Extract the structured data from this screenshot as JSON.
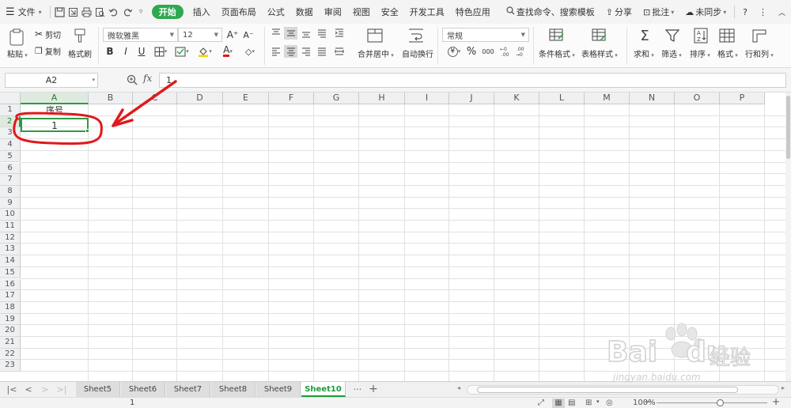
{
  "menubar": {
    "menu_label": "文件",
    "active_tab": "开始",
    "tabs": [
      "插入",
      "页面布局",
      "公式",
      "数据",
      "审阅",
      "视图",
      "安全",
      "开发工具",
      "特色应用"
    ],
    "search_placeholder": "查找命令、搜索模板",
    "share": "分享",
    "comment": "批注",
    "sync": "未同步",
    "help": "?"
  },
  "ribbon": {
    "paste": "粘贴",
    "cut": "剪切",
    "copy": "复制",
    "format_painter": "格式刷",
    "font_name": "微软雅黑",
    "font_size": "12",
    "merge_center": "合并居中",
    "wrap_text": "自动换行",
    "number_format": "常规",
    "conditional_format": "条件格式",
    "table_style": "表格样式",
    "sum": "求和",
    "filter": "筛选",
    "sort": "排序",
    "format": "格式",
    "row_col": "行和列",
    "bold": "B",
    "italic": "I",
    "underline": "U",
    "percent": "%",
    "thousands": "000",
    "font_color_letter": "A",
    "inc_font": "A⁺",
    "dec_font": "A⁻",
    "currency_symbol": "¥"
  },
  "formula_bar": {
    "name_box": "A2",
    "fx_label": "fx",
    "value": "1"
  },
  "grid": {
    "columns": [
      "A",
      "B",
      "C",
      "D",
      "E",
      "F",
      "G",
      "H",
      "I",
      "J",
      "K",
      "L",
      "M",
      "N",
      "O",
      "P"
    ],
    "rows": [
      "1",
      "2",
      "3",
      "4",
      "5",
      "6",
      "7",
      "8",
      "9",
      "10",
      "11",
      "12",
      "13",
      "14",
      "15",
      "16",
      "17",
      "18",
      "19",
      "20",
      "21",
      "22",
      "23"
    ],
    "a1": "序号",
    "a2": "1"
  },
  "sheet_tabs": {
    "tabs": [
      "Sheet5",
      "Sheet6",
      "Sheet7",
      "Sheet8",
      "Sheet9"
    ],
    "active": "Sheet10",
    "more": "···",
    "add": "+"
  },
  "status_bar": {
    "value": "1",
    "zoom": "100%"
  },
  "watermark": {
    "brand": "Bai",
    "brand2": "du",
    "product": "经验",
    "url": "jingyan.baidu.com"
  },
  "colors": {
    "accent_green": "#2fa84f",
    "annotation_red": "#e0191c",
    "selection_green": "#2f9a45"
  }
}
